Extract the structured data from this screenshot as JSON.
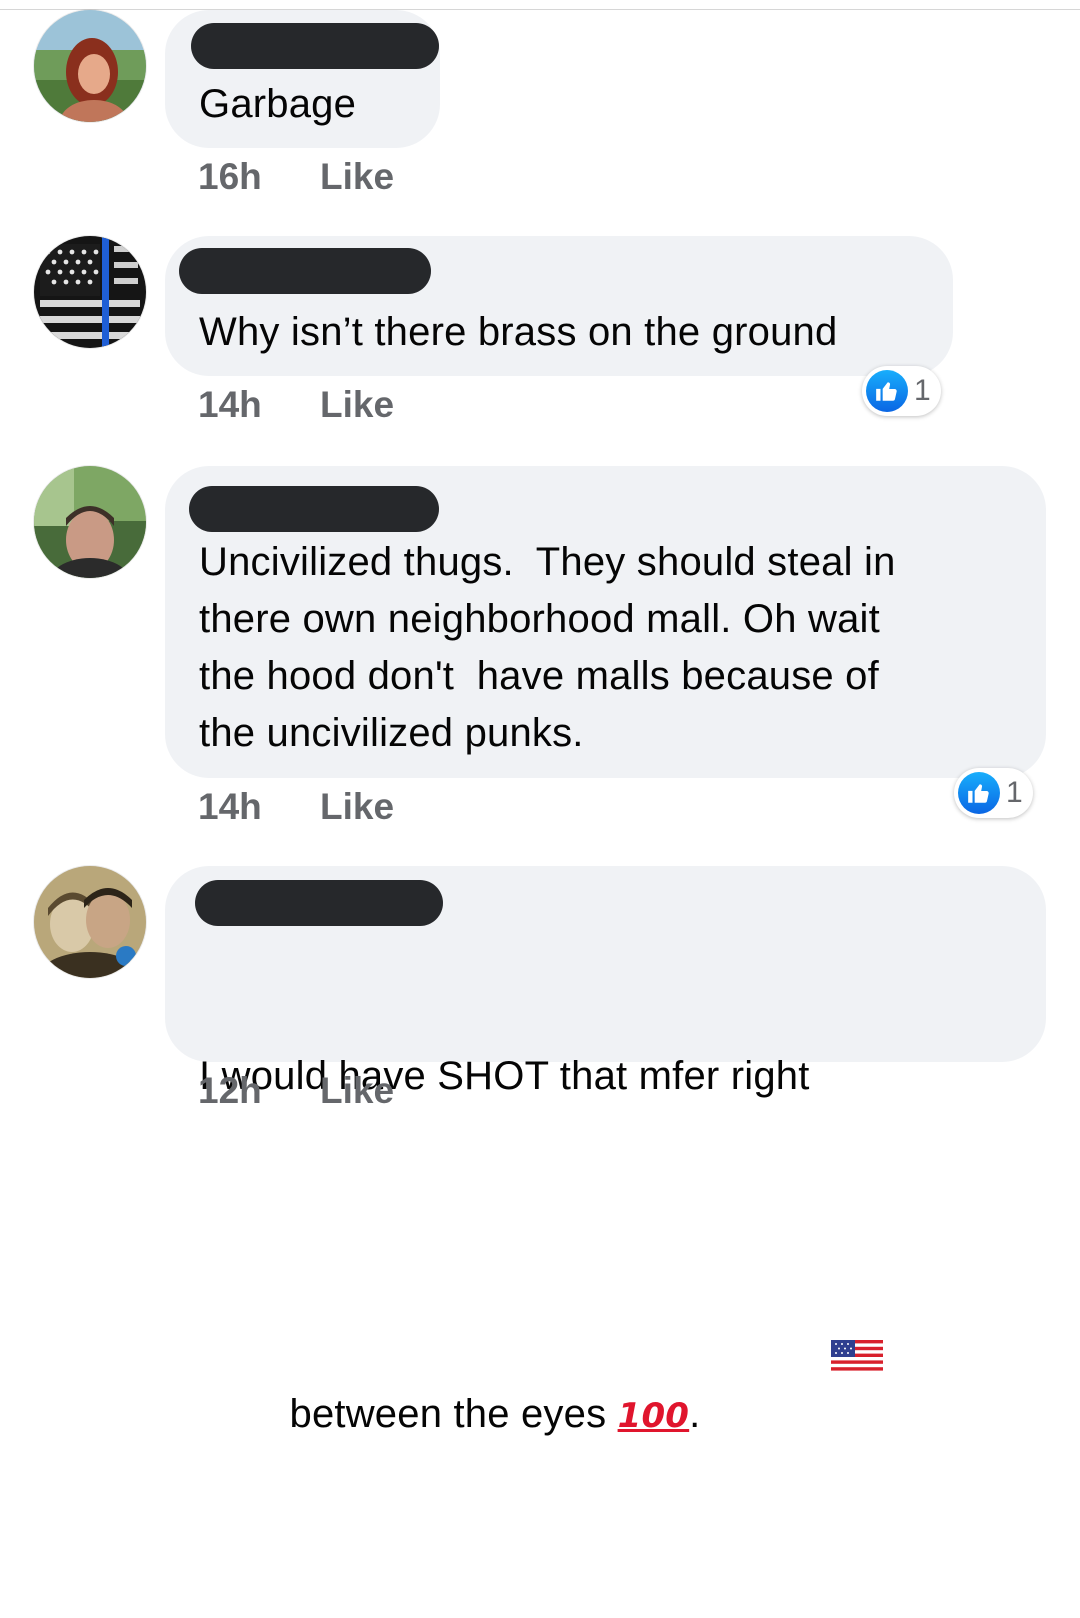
{
  "colors": {
    "bubble_bg": "#f0f2f5",
    "redaction": "#26282b",
    "meta_text": "#65676b",
    "like_blue": "#1877f2"
  },
  "comments": [
    {
      "avatar_icon": "avatar-woman-by-lake",
      "text": "Garbage",
      "time": "16h",
      "like_label": "Like",
      "reaction_count": null
    },
    {
      "avatar_icon": "avatar-thin-blue-line-flag",
      "text": "Why isn’t there brass on the ground",
      "time": "14h",
      "like_label": "Like",
      "reaction_icon": "like-thumb-icon",
      "reaction_count": "1"
    },
    {
      "avatar_icon": "avatar-man-outdoors",
      "text": "Uncivilized thugs.  They should steal in\nthere own neighborhood mall. Oh wait\nthe hood don't  have malls because of\nthe uncivilized punks.",
      "time": "14h",
      "like_label": "Like",
      "reaction_icon": "like-thumb-icon",
      "reaction_count": "1"
    },
    {
      "avatar_icon": "avatar-couple-photo",
      "text_line1": "I would have SHOT that mfer right",
      "text_line2_prefix": "between the eyes ",
      "emoji_100": "100",
      "text_line2_suffix": ". ",
      "flag_icon": "us-flag-icon",
      "time": "12h",
      "like_label": "Like"
    }
  ]
}
